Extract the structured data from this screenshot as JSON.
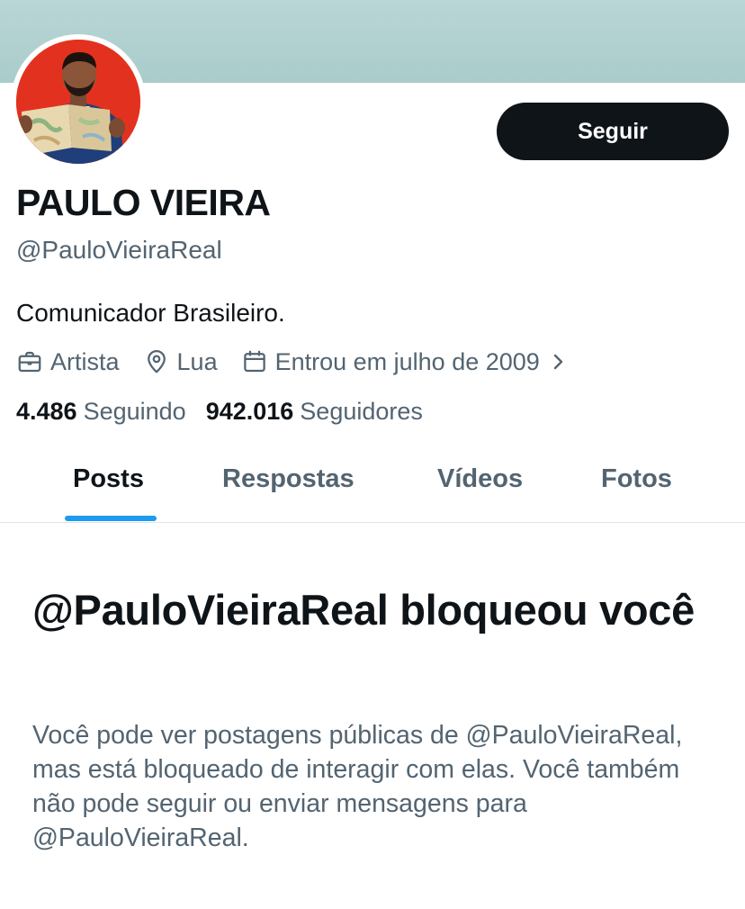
{
  "profile": {
    "name": "PAULO VIEIRA",
    "handle": "@PauloVieiraReal",
    "bio": "Comunicador Brasileiro.",
    "follow_label": "Seguir",
    "category": "Artista",
    "location": "Lua",
    "joined": "Entrou em julho de 2009",
    "following_count": "4.486",
    "following_label": "Seguindo",
    "followers_count": "942.016",
    "followers_label": "Seguidores"
  },
  "tabs": [
    {
      "label": "Posts",
      "active": true
    },
    {
      "label": "Respostas",
      "active": false
    },
    {
      "label": "Vídeos",
      "active": false
    },
    {
      "label": "Fotos",
      "active": false
    }
  ],
  "blocked": {
    "title": "@PauloVieiraReal bloqueou você",
    "description": "Você pode ver postagens públicas de @PauloVieiraReal, mas está bloqueado de interagir com elas. Você também não pode seguir ou enviar mensagens para @PauloVieiraReal."
  },
  "icons": {
    "category": "briefcase-icon",
    "location": "location-pin-icon",
    "joined": "calendar-icon",
    "more": "chevron-right-icon"
  },
  "colors": {
    "accent": "#1d9bf0",
    "text_primary": "#0f1419",
    "text_secondary": "#536471",
    "banner": "#b2d2d1",
    "avatar_background": "#e2321f"
  }
}
